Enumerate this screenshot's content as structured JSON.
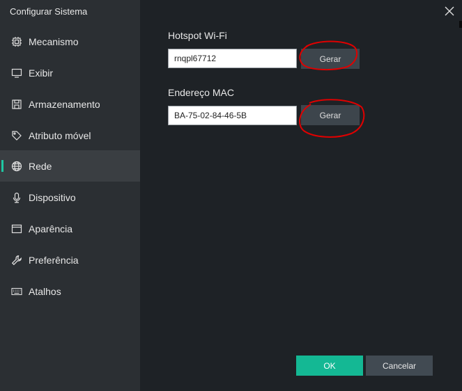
{
  "window": {
    "title": "Configurar Sistema"
  },
  "sidebar": {
    "items": [
      {
        "label": "Mecanismo",
        "icon": "chip-icon",
        "active": false
      },
      {
        "label": "Exibir",
        "icon": "monitor-icon",
        "active": false
      },
      {
        "label": "Armazenamento",
        "icon": "save-icon",
        "active": false
      },
      {
        "label": "Atributo móvel",
        "icon": "tag-icon",
        "active": false
      },
      {
        "label": "Rede",
        "icon": "globe-icon",
        "active": true
      },
      {
        "label": "Dispositivo",
        "icon": "microphone-icon",
        "active": false
      },
      {
        "label": "Aparência",
        "icon": "window-icon",
        "active": false
      },
      {
        "label": "Preferência",
        "icon": "wrench-icon",
        "active": false
      },
      {
        "label": "Atalhos",
        "icon": "keyboard-icon",
        "active": false
      }
    ]
  },
  "network": {
    "hotspot": {
      "label": "Hotspot Wi-Fi",
      "value": "rnqpl67712",
      "button_label": "Gerar"
    },
    "mac": {
      "label": "Endereço MAC",
      "value": "BA-75-02-84-46-5B",
      "button_label": "Gerar"
    }
  },
  "footer": {
    "ok_label": "OK",
    "cancel_label": "Cancelar"
  },
  "colors": {
    "accent": "#14b894",
    "active_indicator": "#1fc8a3",
    "sidebar_bg": "#2b2f33",
    "main_bg": "#1e2226",
    "annotation": "#e00000"
  }
}
